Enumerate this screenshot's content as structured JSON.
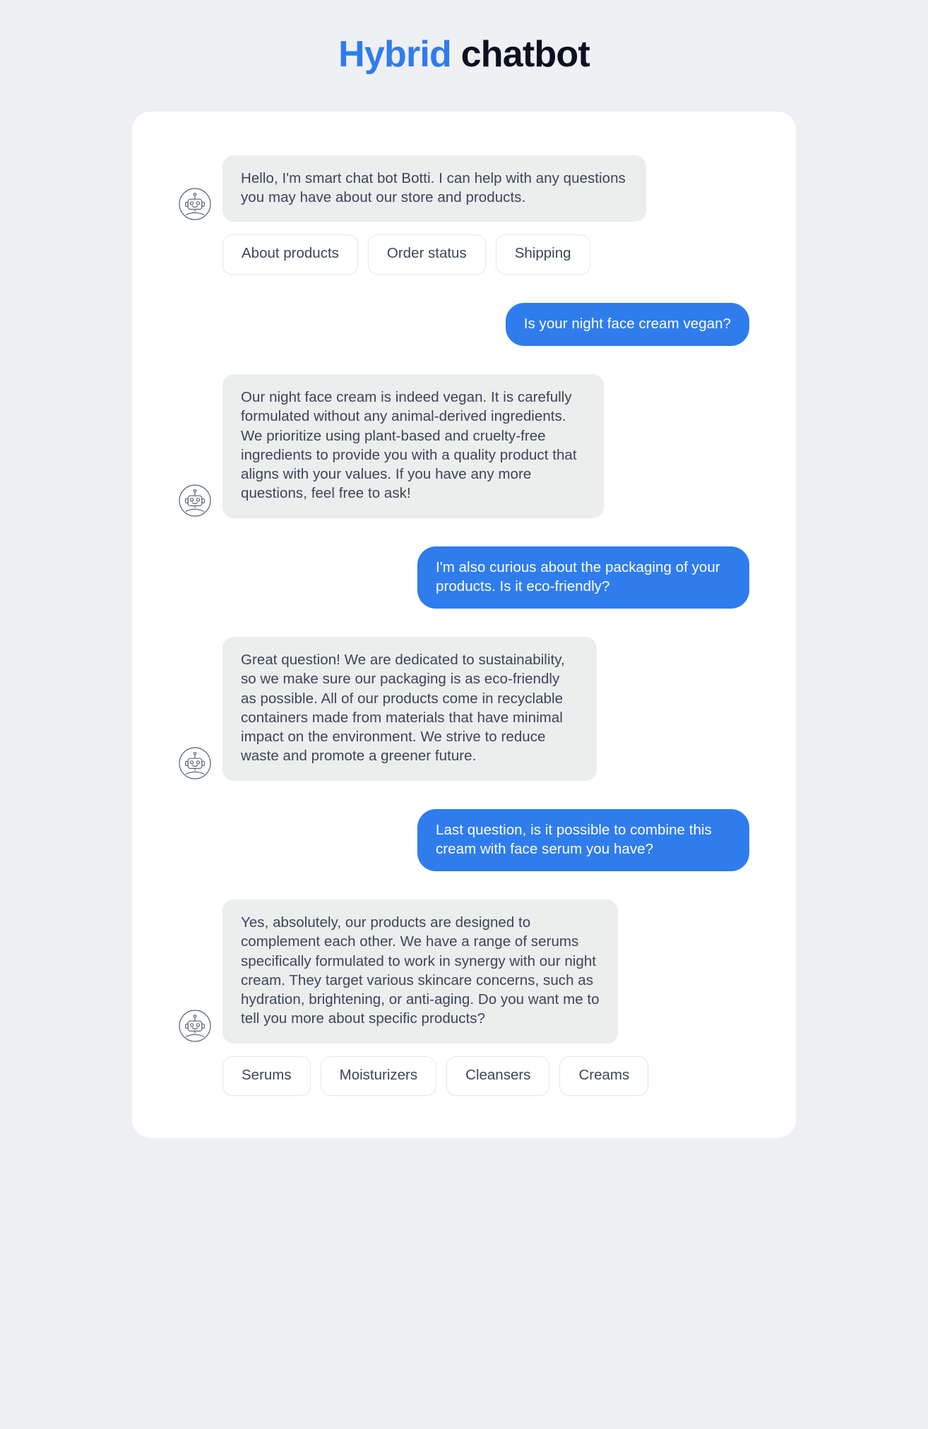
{
  "header": {
    "title_accent": "Hybrid",
    "title_rest": " chatbot"
  },
  "colors": {
    "page_background": "#eff0f4",
    "card_background": "#ffffff",
    "accent_blue": "#2f7ced",
    "bot_bubble": "#eceded",
    "bot_text": "#3b4658",
    "user_text": "#ffffff",
    "title_dark": "#0b1120",
    "chip_border": "#e8e9ee"
  },
  "conversation": [
    {
      "sender": "bot",
      "avatar_icon": "robot-avatar-icon",
      "text": "Hello, I'm smart chat bot Botti. I can help with any questions you may have about our store and products."
    },
    {
      "sender": "user",
      "text": "Is your night face cream vegan?"
    },
    {
      "sender": "bot",
      "avatar_icon": "robot-avatar-icon",
      "text": "Our night face cream is indeed vegan. It is carefully formulated without any animal-derived ingredients. We prioritize using plant-based and cruelty-free ingredients to provide you with a quality product that aligns with your values. If you have any more questions, feel free to ask!"
    },
    {
      "sender": "user",
      "text": "I'm also curious about the packaging of your products. Is it eco-friendly?"
    },
    {
      "sender": "bot",
      "avatar_icon": "robot-avatar-icon",
      "text": "Great question! We are dedicated to sustainability, so we make sure our packaging is as eco-friendly as possible. All of our products come in recyclable containers made from materials that have minimal impact on the environment. We strive to reduce waste and promote a greener future."
    },
    {
      "sender": "user",
      "text": "Last question, is it possible to combine this cream with face serum you have?"
    },
    {
      "sender": "bot",
      "avatar_icon": "robot-avatar-icon",
      "text": "Yes, absolutely, our products are designed to complement each other. We have a range of serums specifically formulated to work in synergy with our night cream. They target various skincare concerns, such as hydration, brightening, or anti-aging. Do you want me to tell you more about specific products?"
    }
  ],
  "quick_replies_top": [
    {
      "label": "About products"
    },
    {
      "label": "Order status"
    },
    {
      "label": "Shipping"
    }
  ],
  "quick_replies_bottom": [
    {
      "label": "Serums"
    },
    {
      "label": "Moisturizers"
    },
    {
      "label": "Cleansers"
    },
    {
      "label": "Creams"
    }
  ]
}
